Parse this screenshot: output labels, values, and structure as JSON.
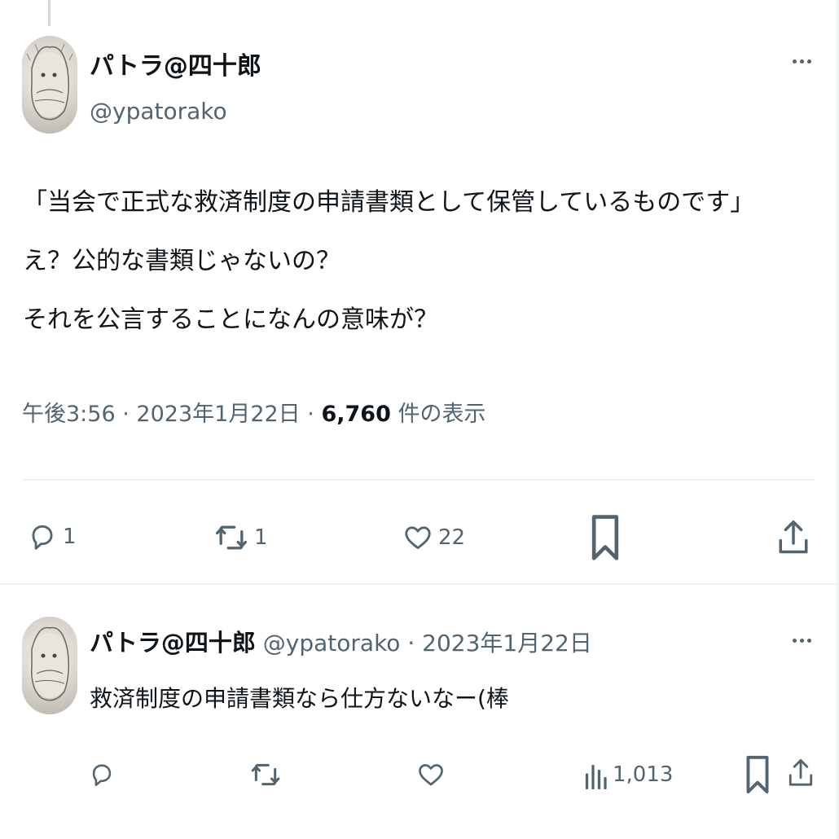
{
  "main_tweet": {
    "display_name": "パトラ@四十郎",
    "handle": "@ypatorako",
    "text_lines": [
      "「当会で正式な救済制度の申請書類として保管しているものです」",
      "え？公的な書類じゃないの？",
      "それを公言することになんの意味が？"
    ],
    "time": "午後3:56",
    "date": "2023年1月22日",
    "views_count": "6,760",
    "views_label": "件の表示",
    "separator": "·",
    "actions": {
      "reply_count": "1",
      "retweet_count": "1",
      "like_count": "22"
    }
  },
  "reply_tweet": {
    "display_name": "パトラ@四十郎",
    "handle": "@ypatorako",
    "separator": "·",
    "date": "2023年1月22日",
    "text": "救済制度の申請書類なら仕方ないなー(棒",
    "actions": {
      "views_count": "1,013"
    }
  },
  "icons": {
    "more": "more-dots-icon",
    "reply": "reply-bubble-icon",
    "retweet": "retweet-icon",
    "like": "heart-icon",
    "bookmark": "bookmark-icon",
    "share": "share-icon",
    "views": "bar-chart-icon"
  },
  "colors": {
    "text_primary": "#0f1419",
    "text_secondary": "#536471",
    "divider": "#eff3f4"
  }
}
